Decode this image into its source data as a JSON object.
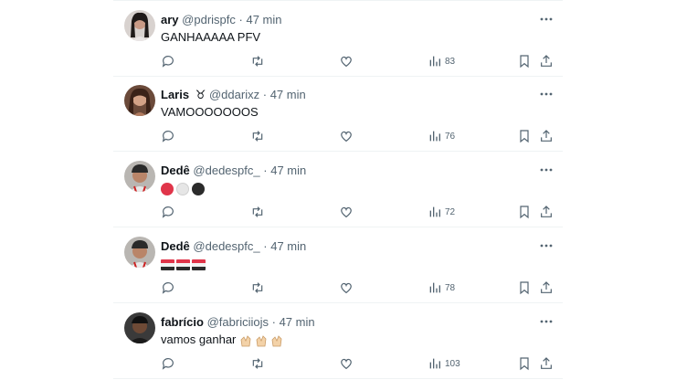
{
  "tweets": [
    {
      "name": "ary",
      "handle": "@pdrispfc",
      "time": "47 min",
      "text": "GANHAAAAA PFV",
      "views": "83",
      "avatar": "avatar-woman-dark-hair"
    },
    {
      "name": "Laris",
      "badge": "♉",
      "handle": "@ddarixz",
      "time": "47 min",
      "text": "VAMOOOOOOOS",
      "views": "76",
      "avatar": "avatar-woman-brown-hair"
    },
    {
      "name": "Dedê",
      "handle": "@dedespfc_",
      "time": "47 min",
      "text": "",
      "emoji": [
        "red-circle",
        "white-circle",
        "black-circle"
      ],
      "views": "72",
      "avatar": "avatar-man-cap"
    },
    {
      "name": "Dedê",
      "handle": "@dedespfc_",
      "time": "47 min",
      "text": "",
      "emoji": [
        "flag-red-white-black",
        "flag-red-white-black",
        "flag-red-white-black"
      ],
      "views": "78",
      "avatar": "avatar-man-cap"
    },
    {
      "name": "fabrício",
      "handle": "@fabriciiojs",
      "time": "47 min",
      "text": "vamos ganhar",
      "emoji": [
        "clapping-hands",
        "clapping-hands",
        "clapping-hands"
      ],
      "views": "103",
      "avatar": "avatar-man-dark"
    }
  ],
  "separator": "·",
  "colors": {
    "text": "#0f1419",
    "muted": "#536471",
    "border": "#eff3f4",
    "red": "#e0354a",
    "black": "#2b2b2b"
  }
}
